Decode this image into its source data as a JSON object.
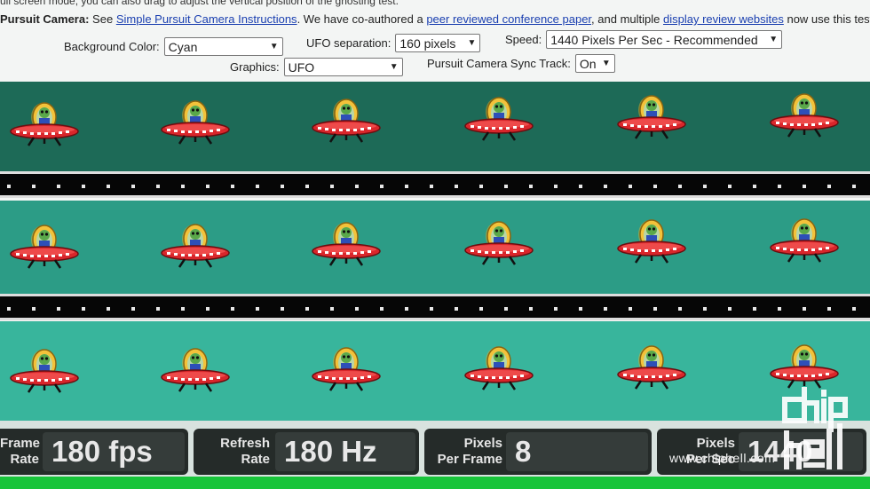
{
  "header": {
    "fullscreen_note": "ull screen mode, you can also drag to adjust the vertical position of the ghosting test.",
    "camera_prefix": "Pursuit Camera:",
    "camera_see": "See",
    "camera_link": "Simple Pursuit Camera Instructions",
    "coauthored_text": ". We have co-authored a",
    "paper_link": "peer reviewed conference paper",
    "multiple_text": ", and multiple",
    "reviews_link": "display review websites",
    "now_text": "now use this test."
  },
  "controls": {
    "background_label": "Background Color:",
    "background_value": "Cyan",
    "separation_label": "UFO separation:",
    "separation_value": "160 pixels",
    "speed_label": "Speed:",
    "speed_value": "1440 Pixels Per Sec - Recommended",
    "graphics_label": "Graphics:",
    "graphics_value": "UFO",
    "sync_label": "Pursuit Camera Sync Track:",
    "sync_value": "On"
  },
  "stats": {
    "frame_rate_label_1": "Frame",
    "frame_rate_label_2": "Rate",
    "frame_rate_value": "180 fps",
    "refresh_label_1": "Refresh",
    "refresh_label_2": "Rate",
    "refresh_value": "180 Hz",
    "ppf_label_1": "Pixels",
    "ppf_label_2": "Per Frame",
    "ppf_value": "8",
    "pps_label_1": "Pixels",
    "pps_label_2": "Per Sec",
    "pps_value": "1440"
  },
  "watermark": {
    "site": "www.chiphell.com",
    "logo_text": "chip hell"
  },
  "colors": {
    "lane_top": "#1d6a57",
    "lane_middle": "#2c9c86",
    "lane_bottom": "#38b59c",
    "track": "#060606",
    "stats_box": "#252b29",
    "stats_green": "#18c43a",
    "link": "#1a3fb0"
  },
  "icons": {
    "ufo": "ufo-sprite-icon",
    "select": "chevron-down-icon"
  }
}
